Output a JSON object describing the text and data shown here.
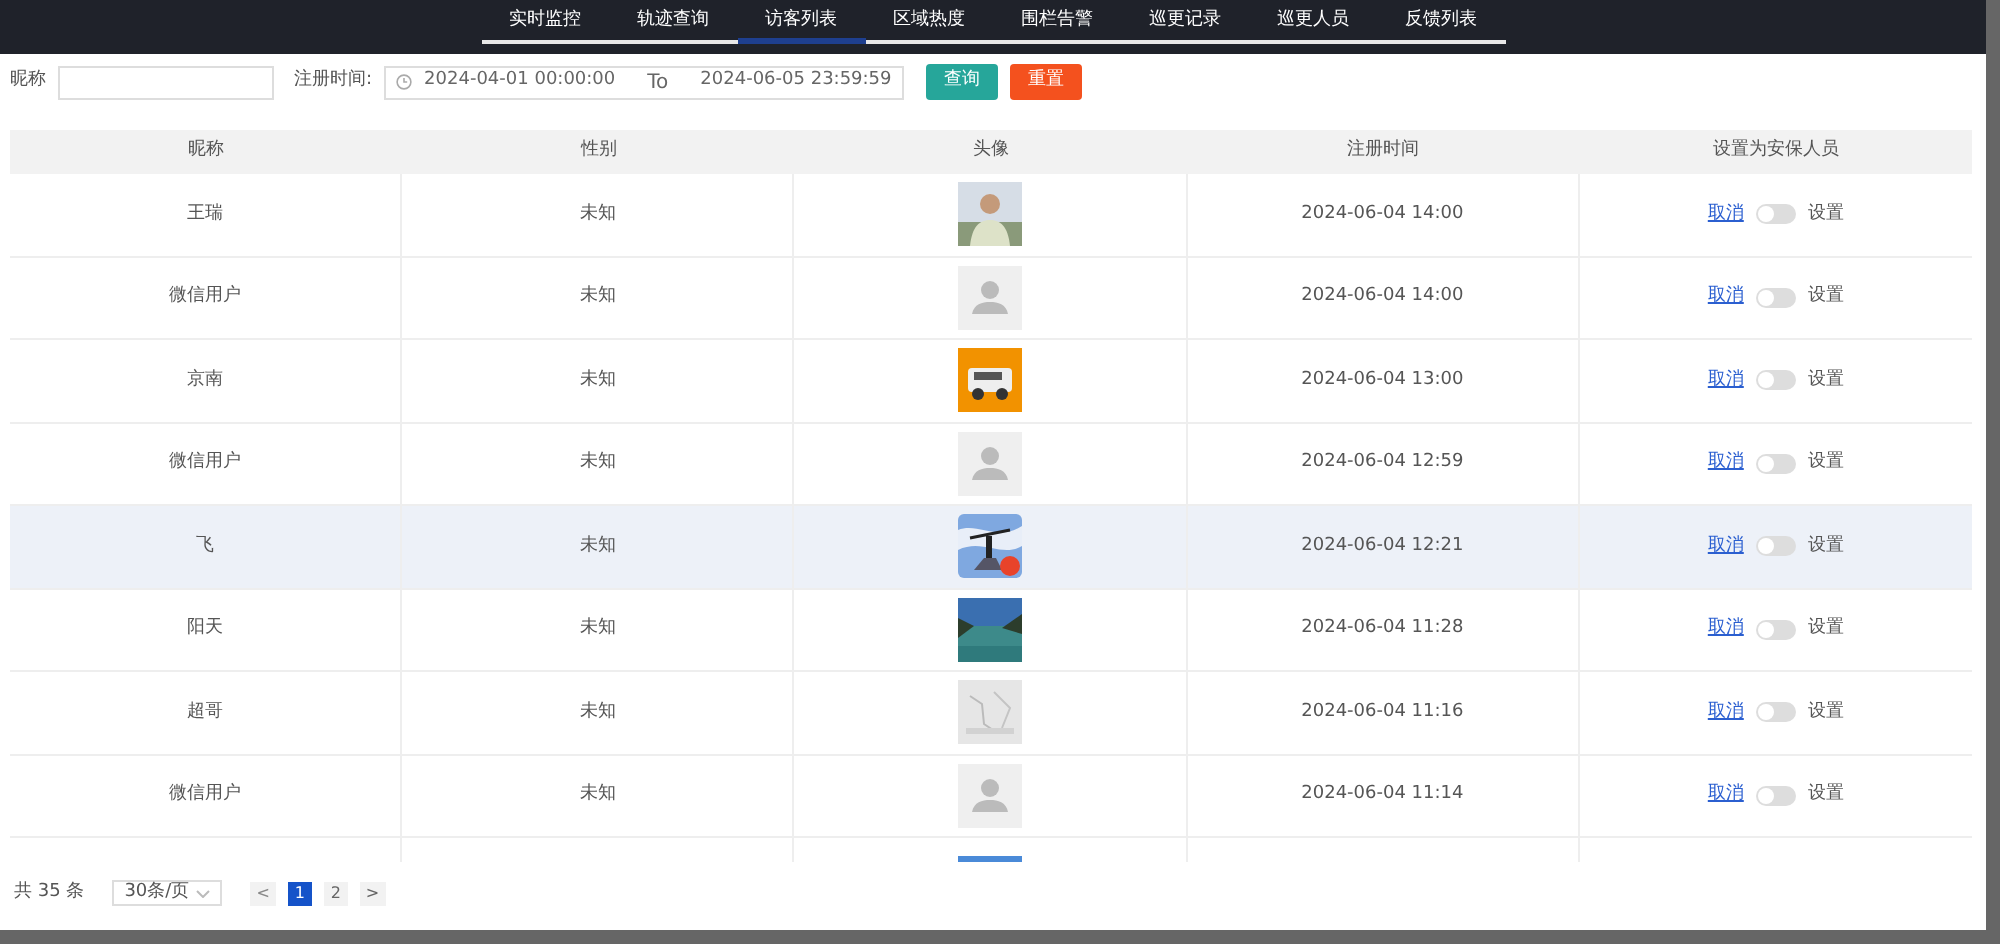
{
  "nav": [
    {
      "label": "实时监控",
      "selected": false
    },
    {
      "label": "轨迹查询",
      "selected": false
    },
    {
      "label": "访客列表",
      "selected": true
    },
    {
      "label": "区域热度",
      "selected": false
    },
    {
      "label": "围栏告警",
      "selected": false
    },
    {
      "label": "巡更记录",
      "selected": false
    },
    {
      "label": "巡更人员",
      "selected": false
    },
    {
      "label": "反馈列表",
      "selected": false
    }
  ],
  "filters": {
    "nickname_label": "昵称",
    "date_label": "注册时间:",
    "date_from": "2024-04-01 00:00:00",
    "date_sep": "To",
    "date_to": "2024-06-05 23:59:59",
    "buttons": [
      "查询",
      "重置"
    ]
  },
  "table": {
    "columns": [
      "昵称",
      "性别",
      "头像",
      "注册时间",
      "设置为安保人员"
    ],
    "rows": [
      {
        "name": "王瑞",
        "gender": "未知",
        "time": "2024-06-04 14:00",
        "cancel": "取消",
        "switch_on": false,
        "set": "设置",
        "highlighted": false
      },
      {
        "name": "微信用户",
        "gender": "未知",
        "avatar": {
          "kind": "default"
        },
        "time": "2024-06-04 14:00",
        "cancel": "取消",
        "switch_on": false,
        "set": "设置",
        "highlighted": false
      },
      {
        "name": "京南",
        "gender": "未知",
        "time": "2024-06-04 13:00",
        "cancel": "取消",
        "switch_on": false,
        "set": "设置",
        "highlighted": false
      },
      {
        "name": "微信用户",
        "gender": "未知",
        "avatar": {
          "kind": "default"
        },
        "time": "2024-06-04 12:59",
        "cancel": "取消",
        "switch_on": false,
        "set": "设置",
        "highlighted": false
      },
      {
        "name": "飞",
        "gender": "未知",
        "time": "2024-06-04 12:21",
        "cancel": "取消",
        "switch_on": false,
        "set": "设置",
        "highlighted": true
      },
      {
        "name": "阳天",
        "gender": "未知",
        "time": "2024-06-04 11:28",
        "cancel": "取消",
        "switch_on": false,
        "set": "设置",
        "highlighted": false
      },
      {
        "name": "超哥",
        "gender": "未知",
        "time": "2024-06-04 11:16",
        "cancel": "取消",
        "switch_on": false,
        "set": "设置",
        "highlighted": false
      },
      {
        "name": "微信用户",
        "gender": "未知",
        "avatar": {
          "kind": "default"
        },
        "time": "2024-06-04 11:14",
        "cancel": "取消",
        "switch_on": false,
        "set": "设置",
        "highlighted": false
      },
      {
        "highlighted": false
      }
    ]
  },
  "pagination": {
    "total": "共 35 条",
    "page_size": "30条/页",
    "prev": "<",
    "pages": [
      {
        "label": "1",
        "selected": true
      },
      {
        "label": "2",
        "selected": false
      }
    ],
    "next": ">"
  }
}
